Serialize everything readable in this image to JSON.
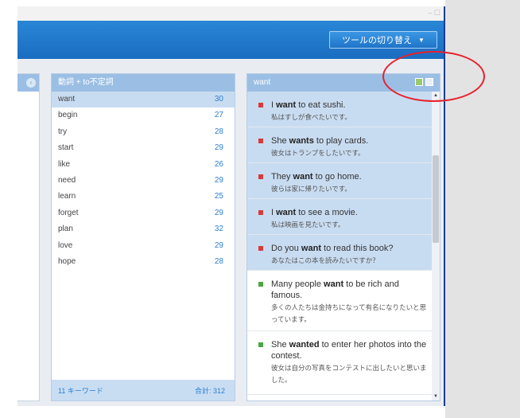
{
  "window": {
    "title": "",
    "tool_switch_label": "ツールの切り替え"
  },
  "middle_panel": {
    "title": "動詞 + to不定詞",
    "words": [
      {
        "word": "want",
        "count": "30"
      },
      {
        "word": "begin",
        "count": "27"
      },
      {
        "word": "try",
        "count": "28"
      },
      {
        "word": "start",
        "count": "29"
      },
      {
        "word": "like",
        "count": "26"
      },
      {
        "word": "need",
        "count": "29"
      },
      {
        "word": "learn",
        "count": "25"
      },
      {
        "word": "forget",
        "count": "29"
      },
      {
        "word": "plan",
        "count": "32"
      },
      {
        "word": "love",
        "count": "29"
      },
      {
        "word": "hope",
        "count": "28"
      }
    ],
    "footer_left": "11 キーワード",
    "footer_right": "合計: 312"
  },
  "right_panel": {
    "title": "want",
    "examples": [
      {
        "pre": "I ",
        "bold": "want",
        "post": " to eat sushi.",
        "ja": "私はすしが食べたいです。"
      },
      {
        "pre": "She ",
        "bold": "wants",
        "post": " to play cards.",
        "ja": "彼女はトランプをしたいです。"
      },
      {
        "pre": "They ",
        "bold": "want",
        "post": " to go home.",
        "ja": "彼らは家に帰りたいです。"
      },
      {
        "pre": "I ",
        "bold": "want",
        "post": " to see a movie.",
        "ja": "私は映画を見たいです。"
      },
      {
        "pre": "Do you ",
        "bold": "want",
        "post": " to read this book?",
        "ja": "あなたはこの本を読みたいですか？"
      },
      {
        "pre": "Many people ",
        "bold": "want",
        "post": " to be rich and famous.",
        "ja": "多くの人たちは金持ちになって有名になりたいと思っています。"
      },
      {
        "pre": "She ",
        "bold": "wanted",
        "post": " to enter her photos into the contest.",
        "ja": "彼女は自分の写真をコンテストに出したいと思いました。"
      }
    ]
  },
  "colors": {
    "accent": "#1a6dc0",
    "panel_header": "#9bbfe4",
    "selected": "#c8dcf1",
    "annotation": "#e8202b"
  }
}
